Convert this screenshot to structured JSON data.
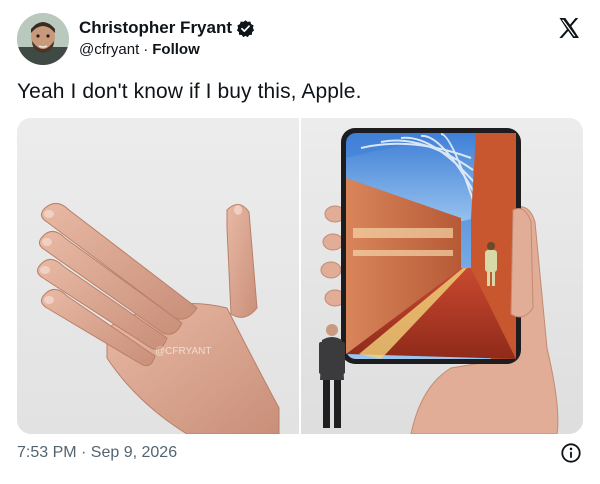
{
  "author": {
    "display_name": "Christopher Fryant",
    "handle": "@cfryant",
    "separator": "·",
    "follow_label": "Follow",
    "verified": true
  },
  "post": {
    "text": "Yeah I don't know if I buy this, Apple.",
    "watermark": "@CFRYANT"
  },
  "meta": {
    "timestamp": "7:53 PM · Sep 9, 2026"
  },
  "icons": {
    "verified": "verified-badge-icon",
    "logo": "x-logo-icon",
    "info": "info-icon"
  },
  "colors": {
    "text": "#0f1419",
    "secondary": "#536471",
    "background": "#ffffff"
  }
}
